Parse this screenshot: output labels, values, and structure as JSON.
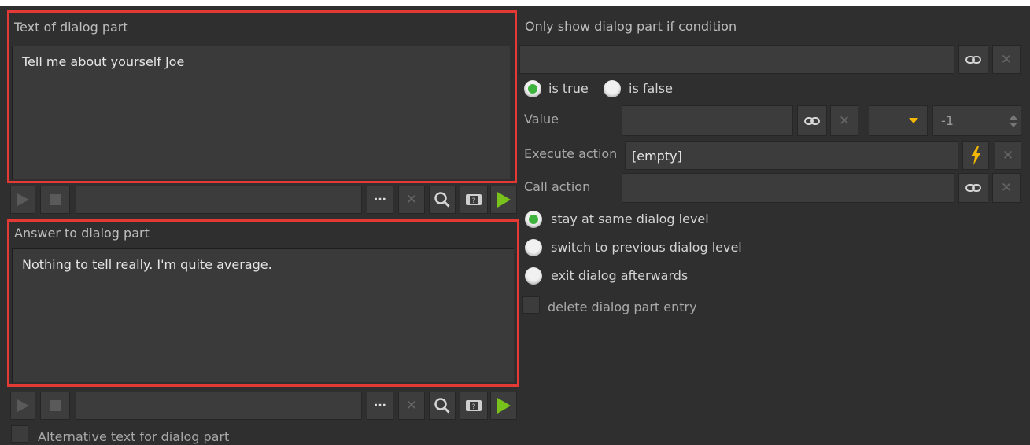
{
  "dialog_text": {
    "title": "Text of dialog part",
    "value": "Tell me about yourself Joe"
  },
  "answer": {
    "title": "Answer to dialog part",
    "value": "Nothing to tell really. I'm quite average."
  },
  "toolbar": {
    "more_label": "···"
  },
  "condition": {
    "title": "Only show dialog part if condition",
    "is_true_label": "is true",
    "is_false_label": "is false",
    "selected": "is true"
  },
  "value_row": {
    "label": "Value",
    "number": "-1"
  },
  "execute_action": {
    "label": "Execute action",
    "value": "[empty]"
  },
  "call_action": {
    "label": "Call action"
  },
  "dialog_level": {
    "options": [
      "stay at same dialog level",
      "switch to previous dialog level",
      "exit dialog afterwards"
    ],
    "selected": "stay at same dialog level"
  },
  "delete_entry_label": "delete dialog part entry",
  "alternative_text_label": "Alternative text for dialog part",
  "colors": {
    "highlight": "#e53935",
    "play_green": "#79c21b",
    "radio_on": "#3eb33e",
    "bolt": "#f2b705"
  },
  "icons": [
    "play-icon",
    "stop-icon",
    "more-icon",
    "clear-icon",
    "search-icon",
    "help-icon",
    "link-icon",
    "close-icon",
    "bolt-icon",
    "dropdown-arrow-icon",
    "spinner-icon"
  ]
}
